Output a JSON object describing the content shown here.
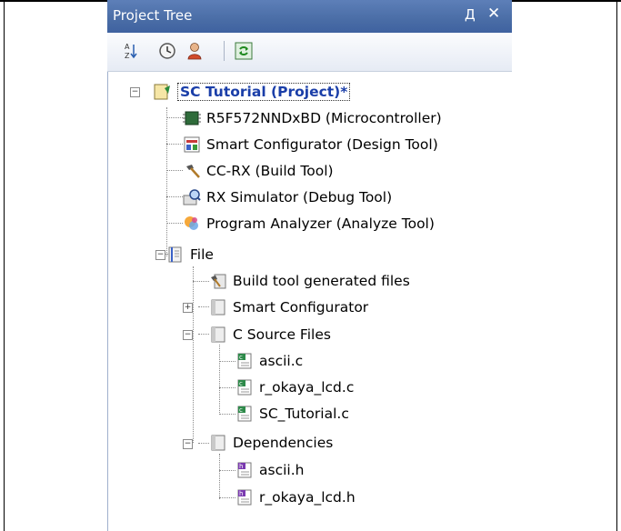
{
  "panel": {
    "title": "Project Tree",
    "pin_icon": "pin-icon",
    "close_icon": "close-icon",
    "pin_glyph": "Д",
    "close_glyph": "✕"
  },
  "toolbar": {
    "sort_icon": "sort-az-icon",
    "clock_icon": "clock-icon",
    "user_icon": "user-icon",
    "refresh_icon": "refresh-icon"
  },
  "tree": {
    "project": "SC Tutorial (Project)*",
    "microcontroller": "R5F572NNDxBD (Microcontroller)",
    "design_tool": "Smart Configurator (Design Tool)",
    "build_tool": "CC-RX (Build Tool)",
    "debug_tool": "RX Simulator (Debug Tool)",
    "analyze_tool": "Program Analyzer (Analyze Tool)",
    "file_folder": "File",
    "generated_files": "Build tool generated files",
    "smart_configurator": "Smart Configurator",
    "c_source_files": "C Source Files",
    "file_ascii_c": "ascii.c",
    "file_lcd_c": "r_okaya_lcd.c",
    "file_tutorial_c": "SC_Tutorial.c",
    "dependencies": "Dependencies",
    "file_ascii_h": "ascii.h",
    "file_lcd_h": "r_okaya_lcd.h"
  },
  "colors": {
    "title_bar": "#4a6da6",
    "selected_text": "#1a3ea8"
  }
}
